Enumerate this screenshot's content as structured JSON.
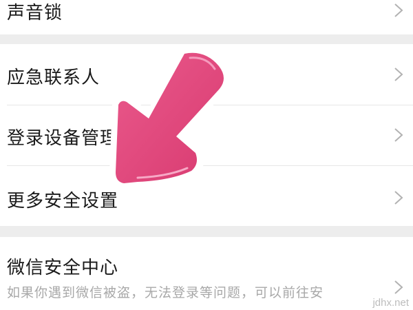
{
  "menu": {
    "voice_lock": "声音锁",
    "emergency_contacts": "应急联系人",
    "login_device_management": "登录设备管理",
    "more_security_settings": "更多安全设置",
    "wechat_security_center": "微信安全中心",
    "security_center_description": "如果你遇到微信被盗，无法登录等问题，可以前往安"
  },
  "watermark": "jdhx.net",
  "colors": {
    "page_background": "#ededed",
    "row_background": "#ffffff",
    "text_primary": "#1a1a1a",
    "text_secondary": "#a8a8a8",
    "arrow": "#e0467c"
  },
  "icons": {
    "row_chevron": "chevron-right-icon",
    "annotation": "pointer-arrow-icon"
  }
}
